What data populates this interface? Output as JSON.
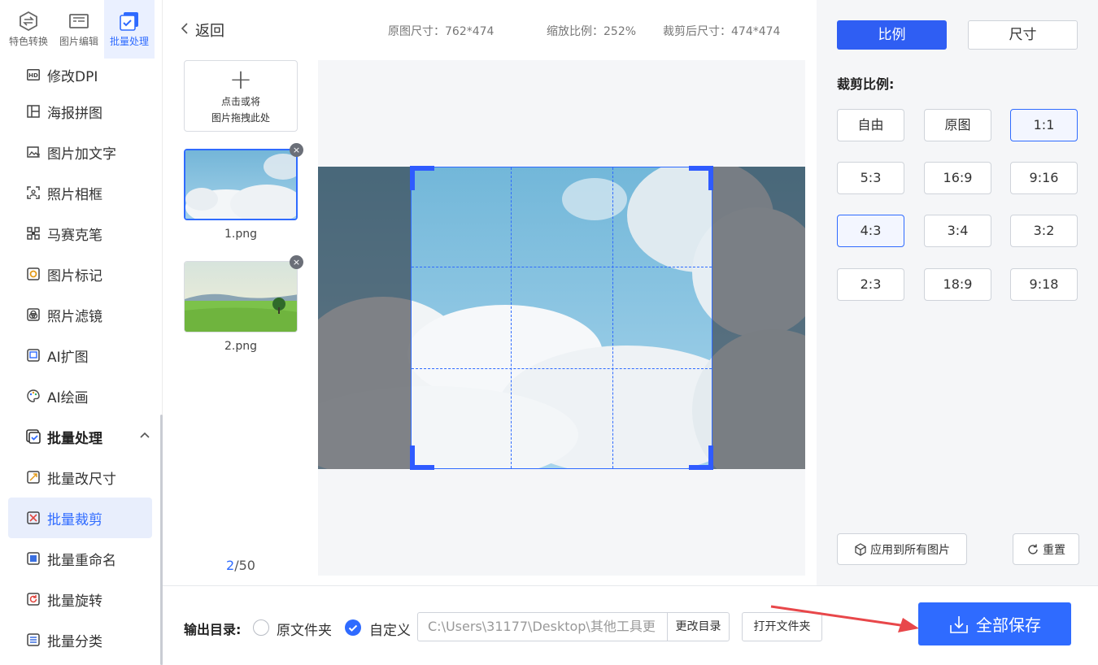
{
  "sidebar": {
    "top_tabs": [
      {
        "label": "特色转换",
        "icon": "convert-icon"
      },
      {
        "label": "图片编辑",
        "icon": "image-edit-icon"
      },
      {
        "label": "批量处理",
        "icon": "batch-icon"
      }
    ],
    "items": [
      {
        "label": "修改DPI",
        "icon": "hd-icon"
      },
      {
        "label": "海报拼图",
        "icon": "collage-icon"
      },
      {
        "label": "图片加文字",
        "icon": "image-text-icon"
      },
      {
        "label": "照片相框",
        "icon": "frame-icon"
      },
      {
        "label": "马赛克笔",
        "icon": "mosaic-icon"
      },
      {
        "label": "图片标记",
        "icon": "mark-icon"
      },
      {
        "label": "照片滤镜",
        "icon": "filter-icon"
      },
      {
        "label": "AI扩图",
        "icon": "ai-expand-icon"
      },
      {
        "label": "AI绘画",
        "icon": "palette-icon"
      }
    ],
    "group": {
      "label": "批量处理",
      "icon": "batch-check-icon",
      "caret": "^"
    },
    "sub_items": [
      {
        "label": "批量改尺寸",
        "icon": "resize-icon"
      },
      {
        "label": "批量裁剪",
        "icon": "crop-icon",
        "active": true
      },
      {
        "label": "批量重命名",
        "icon": "rename-icon"
      },
      {
        "label": "批量旋转",
        "icon": "rotate-icon"
      },
      {
        "label": "批量分类",
        "icon": "classify-icon"
      }
    ]
  },
  "header": {
    "back_label": "返回",
    "original_size": "原图尺寸：762*474",
    "zoom": "缩放比例：252%",
    "cropped_size": "裁剪后尺寸：474*474"
  },
  "thumbs": {
    "add_line1": "点击或将",
    "add_line2": "图片拖拽此处",
    "files": [
      {
        "name": "1.png",
        "selected": true
      },
      {
        "name": "2.png",
        "selected": false
      }
    ],
    "pager_current": "2",
    "pager_total": "/50"
  },
  "panel": {
    "mode_ratio": "比例",
    "mode_size": "尺寸",
    "ratio_title": "裁剪比例:",
    "ratios": [
      "自由",
      "原图",
      "1:1",
      "5:3",
      "16:9",
      "9:16",
      "4:3",
      "3:4",
      "3:2",
      "2:3",
      "18:9",
      "9:18"
    ],
    "apply_all": "应用到所有图片",
    "reset": "重置"
  },
  "bottom": {
    "output_label": "输出目录:",
    "opt_original": "原文件夹",
    "opt_custom": "自定义",
    "path": "C:\\Users\\31177\\Desktop\\其他工具更",
    "change_dir": "更改目录",
    "open_folder": "打开文件夹",
    "save_all": "全部保存"
  },
  "colors": {
    "accent": "#2f6bff",
    "annotation_arrow": "#e8474a"
  }
}
